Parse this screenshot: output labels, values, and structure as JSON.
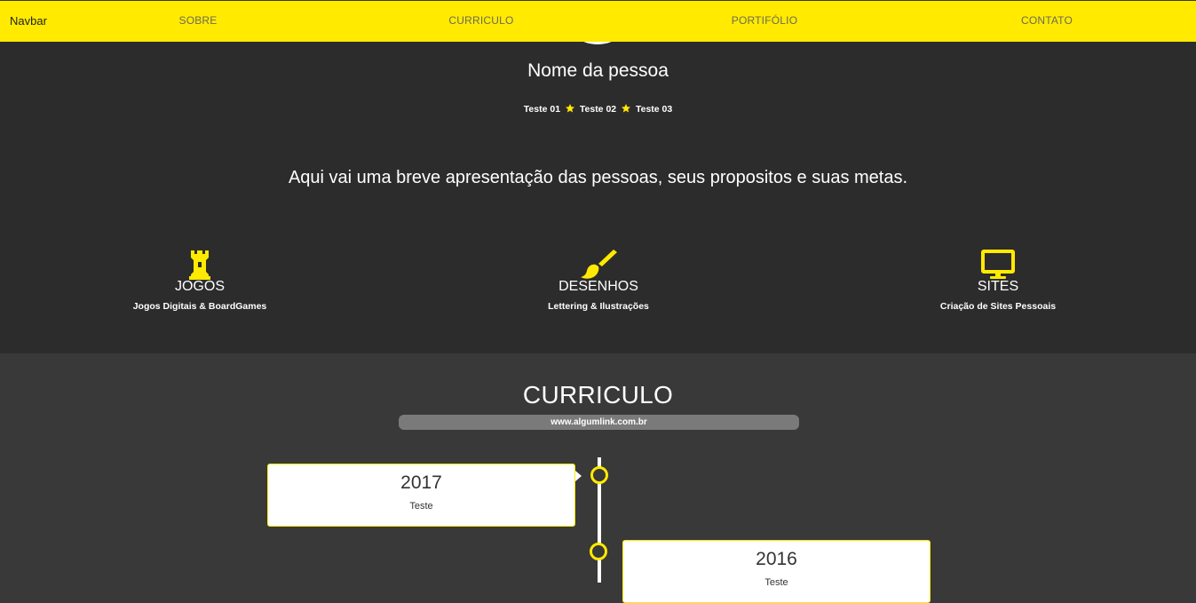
{
  "navbar": {
    "brand": "Navbar",
    "links": [
      "SOBRE",
      "CURRICULO",
      "PORTIFÓLIO",
      "CONTATO"
    ]
  },
  "hero": {
    "name": "Nome da pessoa",
    "tags": [
      "Teste 01",
      "Teste 02",
      "Teste 03"
    ],
    "intro": "Aqui vai uma breve apresentação das pessoas, seus propositos e suas metas.",
    "services": [
      {
        "icon": "chess-rook-icon",
        "title": "JOGOS",
        "desc": "Jogos Digitais & BoardGames"
      },
      {
        "icon": "paintbrush-icon",
        "title": "DESENHOS",
        "desc": "Lettering & Ilustrações"
      },
      {
        "icon": "monitor-icon",
        "title": "SITES",
        "desc": "Criação de Sites Pessoais"
      }
    ]
  },
  "curriculo": {
    "title": "CURRICULO",
    "link": "www.algumlink.com.br",
    "timeline": [
      {
        "year": "2017",
        "text": "Teste"
      },
      {
        "year": "2016",
        "text": "Teste"
      }
    ]
  },
  "colors": {
    "accent": "#ffea00",
    "hero_bg": "#2c2c2c",
    "section_bg": "#393939"
  }
}
